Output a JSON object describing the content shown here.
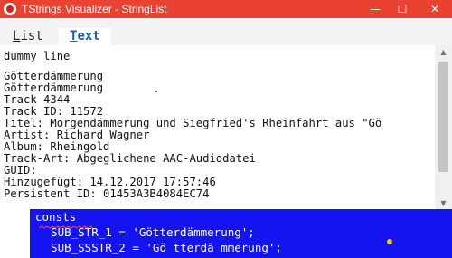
{
  "window": {
    "title": "TStrings Visualizer - StringList",
    "minimize_glyph": "—",
    "maximize_glyph": "☐",
    "close_glyph": "✕"
  },
  "tabs": {
    "list": {
      "accel": "L",
      "rest": "ist"
    },
    "text": {
      "accel": "T",
      "rest": "ext"
    },
    "active": "Text"
  },
  "editor": {
    "lines": [
      "dummy line",
      "",
      "Götterdämmerung",
      "Götterdämmerung",
      "Track 4344",
      "Track ID: 11572",
      "Titel: Morgendämmerung und Siegfried's Rheinfahrt aus \"Gö",
      "Artist: Richard Wagner",
      "Album: Rheingold",
      "Track-Art: Abgeglichene AAC-Audiodatei",
      "GUID:",
      "Hinzugefügt: 14.12.2017 17:57:46",
      "Persistent ID: 01453A3B4084EC74"
    ]
  },
  "scrollbar": {
    "up_glyph": "▲",
    "down_glyph": "▼"
  },
  "code_panel": {
    "lines": [
      "consts",
      "  SUB_STR_1 = 'Götterdämmerung';",
      "  SUB_SSSTR_2 = 'Gö tterdä mmerung';"
    ]
  },
  "colors": {
    "titlebar": "#ea4230",
    "active_tab_text": "#1e5aa6",
    "code_panel_bg": "#1414f0",
    "breakpoint_dot": "#ffc800"
  }
}
